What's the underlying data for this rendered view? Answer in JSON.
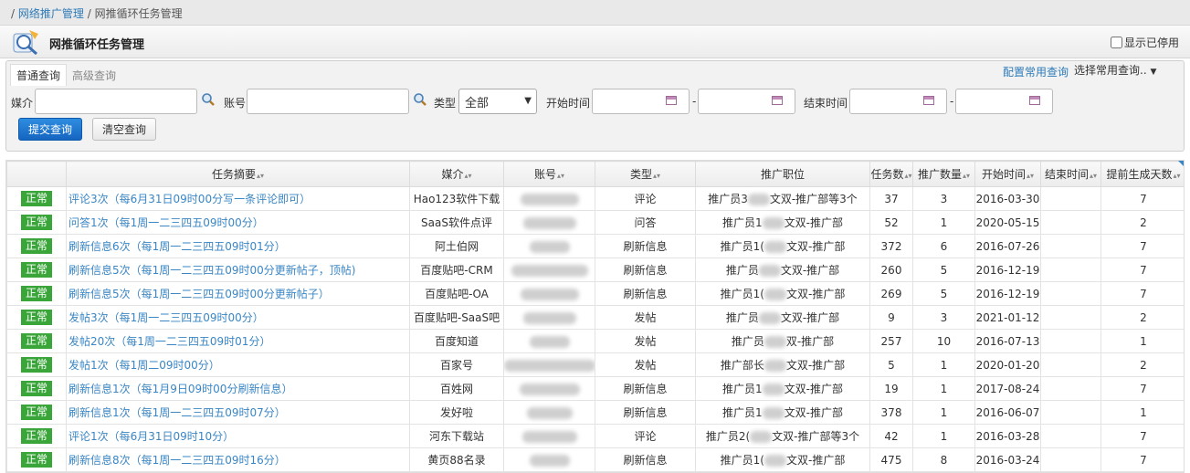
{
  "breadcrumb": {
    "sep1": "/",
    "parent": "网络推广管理",
    "sep2": "/",
    "current": "网推循环任务管理"
  },
  "header": {
    "title": "网推循环任务管理",
    "show_stopped_label": "显示已停用"
  },
  "query": {
    "tabs": [
      "普通查询",
      "高级查询"
    ],
    "config_link": "配置常用查询",
    "common_select": "选择常用查询..",
    "media_label": "媒介",
    "account_label": "账号",
    "type_label": "类型",
    "type_value": "全部",
    "start_label": "开始时间",
    "end_label": "结束时间",
    "dash": "-",
    "submit": "提交查询",
    "clear": "清空查询"
  },
  "table": {
    "headers": [
      "任务摘要",
      "媒介",
      "账号",
      "类型",
      "推广职位",
      "任务数",
      "推广数量",
      "开始时间",
      "结束时间",
      "提前生成天数"
    ],
    "sortable": [
      true,
      true,
      true,
      true,
      false,
      true,
      true,
      true,
      true,
      true
    ],
    "rows": [
      {
        "status": "正常",
        "task": "评论3次（每6月31日09时00分写一条评论即可）",
        "media": "Hao123软件下载",
        "type": "评论",
        "position_pre": "推广员3",
        "position_post": "文双-推广部等3个",
        "count": "37",
        "qty": "3",
        "start": "2016-03-30",
        "end": "",
        "days": "7"
      },
      {
        "status": "正常",
        "task": "问答1次（每1周一二三四五09时00分）",
        "media": "SaaS软件点评",
        "type": "问答",
        "position_pre": "推广员1",
        "position_post": "文双-推广部",
        "count": "52",
        "qty": "1",
        "start": "2020-05-15",
        "end": "",
        "days": "2"
      },
      {
        "status": "正常",
        "task": "刷新信息6次（每1周一二三四五09时01分）",
        "media": "阿土伯网",
        "type": "刷新信息",
        "position_pre": "推广员1(",
        "position_post": "文双-推广部",
        "count": "372",
        "qty": "6",
        "start": "2016-07-26",
        "end": "",
        "days": "7"
      },
      {
        "status": "正常",
        "task": "刷新信息5次（每1周一二三四五09时00分更新帖子，顶帖)",
        "media": "百度贴吧-CRM",
        "type": "刷新信息",
        "position_pre": "推广员",
        "position_post": "文双-推广部",
        "count": "260",
        "qty": "5",
        "start": "2016-12-19",
        "end": "",
        "days": "7"
      },
      {
        "status": "正常",
        "task": "刷新信息5次（每1周一二三四五09时00分更新帖子）",
        "media": "百度贴吧-OA",
        "type": "刷新信息",
        "position_pre": "推广员1(",
        "position_post": "文双-推广部",
        "count": "269",
        "qty": "5",
        "start": "2016-12-19",
        "end": "",
        "days": "7"
      },
      {
        "status": "正常",
        "task": "发帖3次（每1周一二三四五09时00分）",
        "media": "百度贴吧-SaaS吧",
        "type": "发帖",
        "position_pre": "推广员",
        "position_post": "文双-推广部",
        "count": "9",
        "qty": "3",
        "start": "2021-01-12",
        "end": "",
        "days": "2"
      },
      {
        "status": "正常",
        "task": "发帖20次（每1周一二三四五09时01分）",
        "media": "百度知道",
        "type": "发帖",
        "position_pre": "推广员",
        "position_post": "双-推广部",
        "count": "257",
        "qty": "10",
        "start": "2016-07-13",
        "end": "",
        "days": "1"
      },
      {
        "status": "正常",
        "task": "发帖1次（每1周二09时00分）",
        "media": "百家号",
        "type": "发帖",
        "position_pre": "推广部长",
        "position_post": "文双-推广部",
        "count": "5",
        "qty": "1",
        "start": "2020-01-20",
        "end": "",
        "days": "2"
      },
      {
        "status": "正常",
        "task": "刷新信息1次（每1月9日09时00分刷新信息）",
        "media": "百姓网",
        "type": "刷新信息",
        "position_pre": "推广员1",
        "position_post": "文双-推广部",
        "count": "19",
        "qty": "1",
        "start": "2017-08-24",
        "end": "",
        "days": "7"
      },
      {
        "status": "正常",
        "task": "刷新信息1次（每1周一二三四五09时07分）",
        "media": "发好啦",
        "type": "刷新信息",
        "position_pre": "推广员1",
        "position_post": "文双-推广部",
        "count": "378",
        "qty": "1",
        "start": "2016-06-07",
        "end": "",
        "days": "1"
      },
      {
        "status": "正常",
        "task": "评论1次（每6月31日09时10分）",
        "media": "河东下载站",
        "type": "评论",
        "position_pre": "推广员2(",
        "position_post": "文双-推广部等3个",
        "count": "42",
        "qty": "1",
        "start": "2016-03-28",
        "end": "",
        "days": "7"
      },
      {
        "status": "正常",
        "task": "刷新信息8次（每1周一二三四五09时16分）",
        "media": "黄页88名录",
        "type": "刷新信息",
        "position_pre": "推广员1(",
        "position_post": "文双-推广部",
        "count": "475",
        "qty": "8",
        "start": "2016-03-24",
        "end": "",
        "days": "7"
      }
    ]
  }
}
